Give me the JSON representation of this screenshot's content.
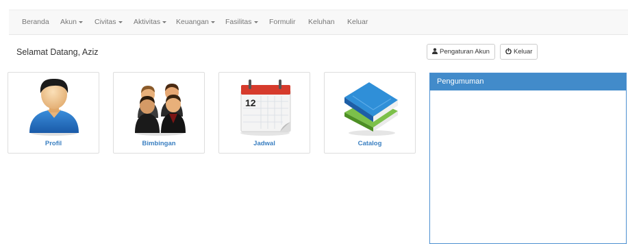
{
  "nav": {
    "items": [
      {
        "label": "Beranda",
        "dropdown": false
      },
      {
        "label": "Akun",
        "dropdown": true
      },
      {
        "label": "Civitas",
        "dropdown": true
      },
      {
        "label": "Aktivitas",
        "dropdown": true
      },
      {
        "label": "Keuangan",
        "dropdown": true
      },
      {
        "label": "Fasilitas",
        "dropdown": true
      },
      {
        "label": "Formulir",
        "dropdown": false
      },
      {
        "label": "Keluhan",
        "dropdown": false
      },
      {
        "label": "Keluar",
        "dropdown": false
      }
    ]
  },
  "welcome": "Selamat Datang, Aziz",
  "buttons": {
    "account_settings": "Pengaturan Akun",
    "logout": "Keluar"
  },
  "tiles": [
    {
      "label": "Profil",
      "icon": "user-profile-icon"
    },
    {
      "label": "Bimbingan",
      "icon": "group-people-icon"
    },
    {
      "label": "Jadwal",
      "icon": "calendar-icon"
    },
    {
      "label": "Catalog",
      "icon": "books-icon"
    }
  ],
  "calendar_day": "12",
  "announcements": {
    "title": "Pengumuman"
  },
  "colors": {
    "accent": "#428bca",
    "tile_label": "#3a7fc1",
    "navbar_bg": "#f8f8f8"
  }
}
